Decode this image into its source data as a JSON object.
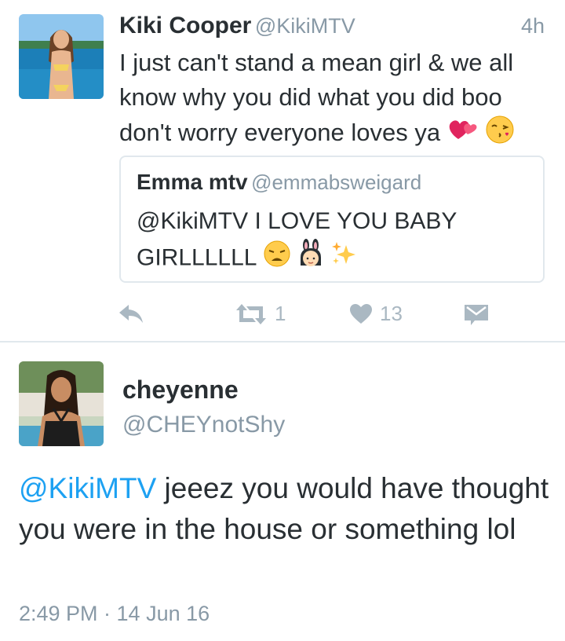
{
  "tweet1": {
    "author_name": "Kiki Cooper",
    "author_handle": "@KikiMTV",
    "time": "4h",
    "text": "I just can't stand a mean girl & we all know why you did what you did boo don't worry everyone loves ya",
    "quoted": {
      "author_name": "Emma mtv",
      "author_handle": "@emmabsweigard",
      "mention": "@KikiMTV",
      "text_line1": "I LOVE YOU BABY",
      "text_line2": "GIRLLLLLL"
    },
    "actions": {
      "reply_icon": "reply-icon",
      "retweet_icon": "retweet-icon",
      "retweet_count": "1",
      "like_icon": "heart-icon",
      "like_count": "13",
      "message_icon": "direct-message-icon"
    }
  },
  "tweet2": {
    "author_name": "cheyenne",
    "author_handle": "@CHEYnotShy",
    "mention": "@KikiMTV",
    "text_rest": " jeeez you would have thought you were in the house or something lol",
    "timestamp": "2:49 PM · 14 Jun 16"
  },
  "colors": {
    "accent": "#1da1f2",
    "text": "#292f33",
    "muted": "#8899a6",
    "icon": "#aab8c2",
    "border": "#e1e8ed"
  }
}
